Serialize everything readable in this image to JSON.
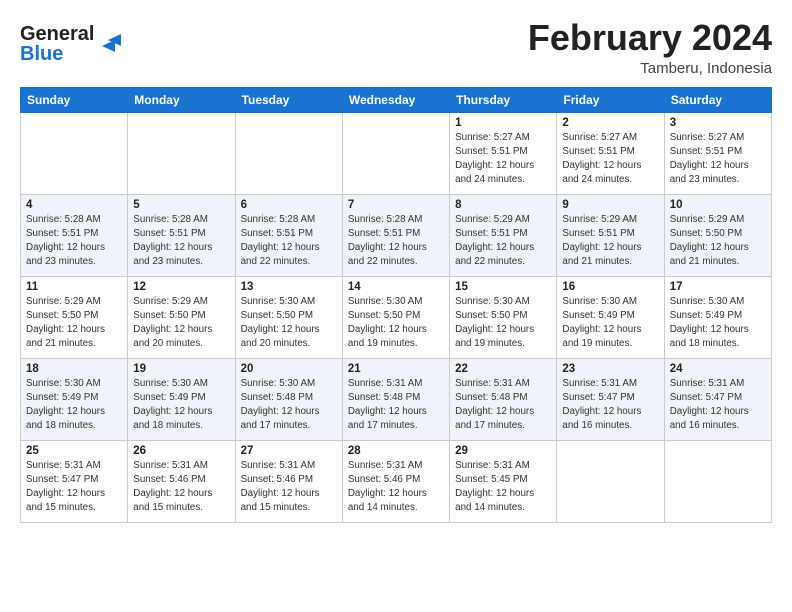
{
  "logo": {
    "line1": "General",
    "line2": "Blue",
    "icon": "▶"
  },
  "title": "February 2024",
  "subtitle": "Tamberu, Indonesia",
  "days_of_week": [
    "Sunday",
    "Monday",
    "Tuesday",
    "Wednesday",
    "Thursday",
    "Friday",
    "Saturday"
  ],
  "weeks": [
    [
      {
        "day": "",
        "info": ""
      },
      {
        "day": "",
        "info": ""
      },
      {
        "day": "",
        "info": ""
      },
      {
        "day": "",
        "info": ""
      },
      {
        "day": "1",
        "info": "Sunrise: 5:27 AM\nSunset: 5:51 PM\nDaylight: 12 hours\nand 24 minutes."
      },
      {
        "day": "2",
        "info": "Sunrise: 5:27 AM\nSunset: 5:51 PM\nDaylight: 12 hours\nand 24 minutes."
      },
      {
        "day": "3",
        "info": "Sunrise: 5:27 AM\nSunset: 5:51 PM\nDaylight: 12 hours\nand 23 minutes."
      }
    ],
    [
      {
        "day": "4",
        "info": "Sunrise: 5:28 AM\nSunset: 5:51 PM\nDaylight: 12 hours\nand 23 minutes."
      },
      {
        "day": "5",
        "info": "Sunrise: 5:28 AM\nSunset: 5:51 PM\nDaylight: 12 hours\nand 23 minutes."
      },
      {
        "day": "6",
        "info": "Sunrise: 5:28 AM\nSunset: 5:51 PM\nDaylight: 12 hours\nand 22 minutes."
      },
      {
        "day": "7",
        "info": "Sunrise: 5:28 AM\nSunset: 5:51 PM\nDaylight: 12 hours\nand 22 minutes."
      },
      {
        "day": "8",
        "info": "Sunrise: 5:29 AM\nSunset: 5:51 PM\nDaylight: 12 hours\nand 22 minutes."
      },
      {
        "day": "9",
        "info": "Sunrise: 5:29 AM\nSunset: 5:51 PM\nDaylight: 12 hours\nand 21 minutes."
      },
      {
        "day": "10",
        "info": "Sunrise: 5:29 AM\nSunset: 5:50 PM\nDaylight: 12 hours\nand 21 minutes."
      }
    ],
    [
      {
        "day": "11",
        "info": "Sunrise: 5:29 AM\nSunset: 5:50 PM\nDaylight: 12 hours\nand 21 minutes."
      },
      {
        "day": "12",
        "info": "Sunrise: 5:29 AM\nSunset: 5:50 PM\nDaylight: 12 hours\nand 20 minutes."
      },
      {
        "day": "13",
        "info": "Sunrise: 5:30 AM\nSunset: 5:50 PM\nDaylight: 12 hours\nand 20 minutes."
      },
      {
        "day": "14",
        "info": "Sunrise: 5:30 AM\nSunset: 5:50 PM\nDaylight: 12 hours\nand 19 minutes."
      },
      {
        "day": "15",
        "info": "Sunrise: 5:30 AM\nSunset: 5:50 PM\nDaylight: 12 hours\nand 19 minutes."
      },
      {
        "day": "16",
        "info": "Sunrise: 5:30 AM\nSunset: 5:49 PM\nDaylight: 12 hours\nand 19 minutes."
      },
      {
        "day": "17",
        "info": "Sunrise: 5:30 AM\nSunset: 5:49 PM\nDaylight: 12 hours\nand 18 minutes."
      }
    ],
    [
      {
        "day": "18",
        "info": "Sunrise: 5:30 AM\nSunset: 5:49 PM\nDaylight: 12 hours\nand 18 minutes."
      },
      {
        "day": "19",
        "info": "Sunrise: 5:30 AM\nSunset: 5:49 PM\nDaylight: 12 hours\nand 18 minutes."
      },
      {
        "day": "20",
        "info": "Sunrise: 5:30 AM\nSunset: 5:48 PM\nDaylight: 12 hours\nand 17 minutes."
      },
      {
        "day": "21",
        "info": "Sunrise: 5:31 AM\nSunset: 5:48 PM\nDaylight: 12 hours\nand 17 minutes."
      },
      {
        "day": "22",
        "info": "Sunrise: 5:31 AM\nSunset: 5:48 PM\nDaylight: 12 hours\nand 17 minutes."
      },
      {
        "day": "23",
        "info": "Sunrise: 5:31 AM\nSunset: 5:47 PM\nDaylight: 12 hours\nand 16 minutes."
      },
      {
        "day": "24",
        "info": "Sunrise: 5:31 AM\nSunset: 5:47 PM\nDaylight: 12 hours\nand 16 minutes."
      }
    ],
    [
      {
        "day": "25",
        "info": "Sunrise: 5:31 AM\nSunset: 5:47 PM\nDaylight: 12 hours\nand 15 minutes."
      },
      {
        "day": "26",
        "info": "Sunrise: 5:31 AM\nSunset: 5:46 PM\nDaylight: 12 hours\nand 15 minutes."
      },
      {
        "day": "27",
        "info": "Sunrise: 5:31 AM\nSunset: 5:46 PM\nDaylight: 12 hours\nand 15 minutes."
      },
      {
        "day": "28",
        "info": "Sunrise: 5:31 AM\nSunset: 5:46 PM\nDaylight: 12 hours\nand 14 minutes."
      },
      {
        "day": "29",
        "info": "Sunrise: 5:31 AM\nSunset: 5:45 PM\nDaylight: 12 hours\nand 14 minutes."
      },
      {
        "day": "",
        "info": ""
      },
      {
        "day": "",
        "info": ""
      }
    ]
  ]
}
